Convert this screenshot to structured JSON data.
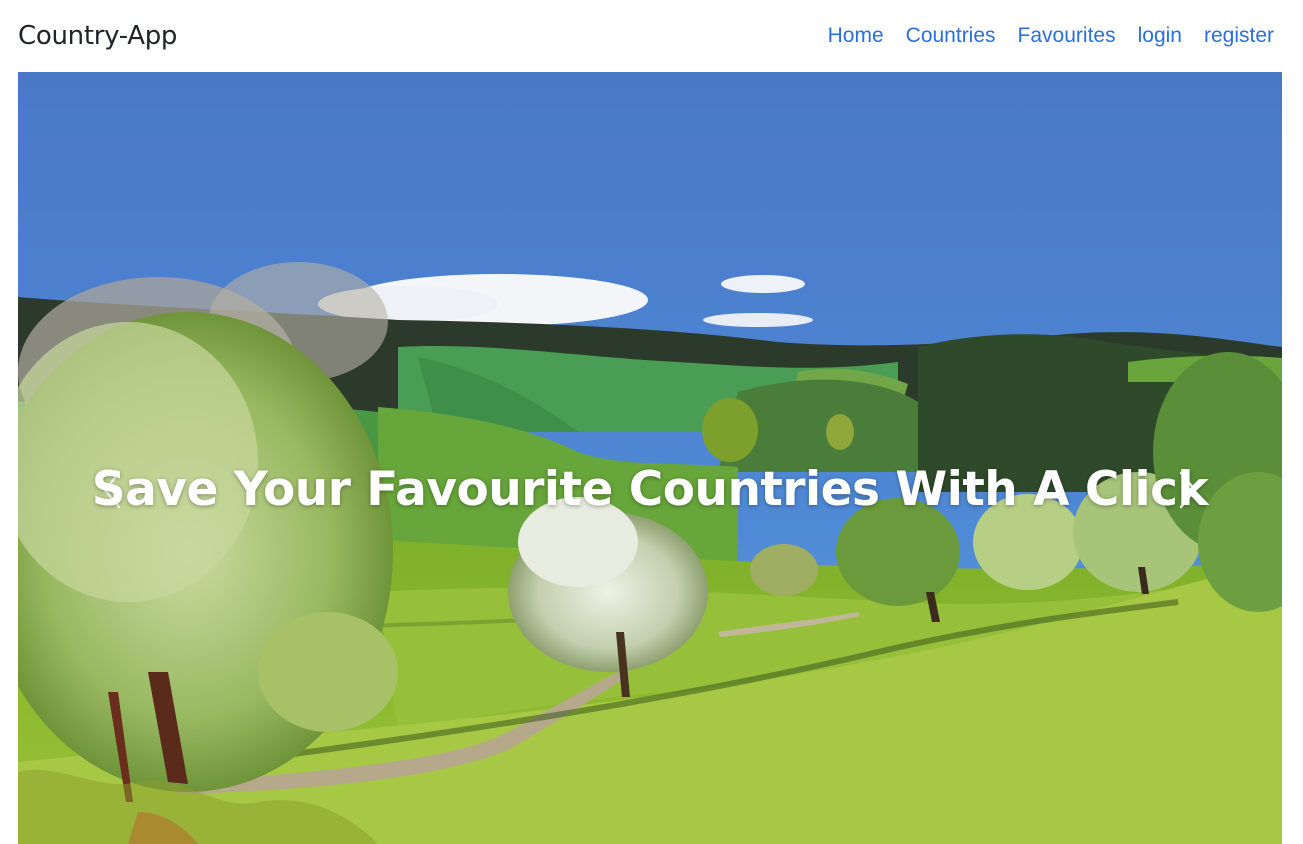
{
  "navbar": {
    "brand": "Country-App",
    "links": [
      "Home",
      "Countries",
      "Favourites",
      "login",
      "register"
    ],
    "link_color": "#2b6fde"
  },
  "carousel": {
    "caption": "Save Your Favourite Countries With A Click",
    "prev_icon": "chevron-left-icon",
    "next_icon": "chevron-right-icon",
    "image": "landscape-photo-green-hills-blossoming-trees-blue-sky"
  }
}
